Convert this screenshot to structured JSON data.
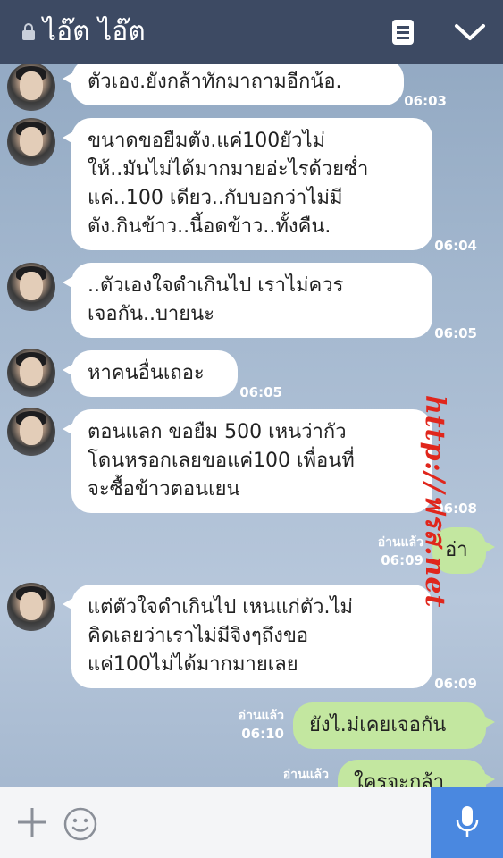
{
  "header": {
    "title": "ไอ๊ต ไอ๊ต",
    "icons": [
      "lock-icon",
      "note-icon",
      "chevron-down-icon"
    ],
    "background": "#3d4a63"
  },
  "messages": [
    {
      "id": "m1",
      "side": "in",
      "text": "ตัวเอง.ยังกล้าทักมาถามอีกน้อ.",
      "time": "06:03"
    },
    {
      "id": "m2",
      "side": "in",
      "text": "ขนาดขอยืมตัง.แค่100ยัวไม่\nให้..มันไม่ได้มากมายอ่ะไรด้วยซ่ำ\nแค่..100 เดียว..กับบอกว่าไม่มี\nตัง.กินข้าว..นี้อดข้าว..ทั้งคืน.",
      "time": "06:04"
    },
    {
      "id": "m3",
      "side": "in",
      "text": "..ตัวเองใจดำเกินไป เราไม่ควร\nเจอกัน..บายนะ",
      "time": "06:05"
    },
    {
      "id": "m4",
      "side": "in",
      "text": "หาคนอื่นเถอะ",
      "time": "06:05"
    },
    {
      "id": "m5",
      "side": "in",
      "text": "ตอนแลก ขอยืม 500 เหนว่ากัว\nโดนหรอกเลยขอแค่100 เพื่อนที่\nจะซื้อข้าวตอนเยน",
      "time": "06:08"
    },
    {
      "id": "m6",
      "side": "out",
      "text": "อ่า",
      "read": "อ่านแล้ว",
      "time": "06:09"
    },
    {
      "id": "m7",
      "side": "in",
      "text": "แต่ตัวใจดำเกินไป เหนแก่ตัว.ไม่\nคิดเลยว่าเราไม่มีจิงๆถึงขอ\nแค่100ไม่ได้มากมายเลย",
      "time": "06:09"
    },
    {
      "id": "m8",
      "side": "out",
      "text": "ยังไ.ม่เคยเจอกัน",
      "read": "อ่านแล้ว",
      "time": "06:10"
    },
    {
      "id": "m9",
      "side": "out",
      "text": "ใครจะกล้า",
      "read": "อ่านแล้ว",
      "time": ""
    }
  ],
  "watermark": "http://ฟรส.net",
  "footer": {
    "icons": [
      "plus-icon",
      "smile-icon",
      "microphone-icon"
    ],
    "mic_color": "#4a88e0"
  },
  "colors": {
    "incoming_bubble": "#ffffff",
    "outgoing_bubble": "#c3e7a0"
  }
}
